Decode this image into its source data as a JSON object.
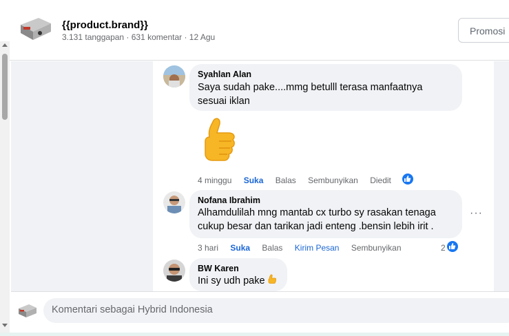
{
  "header": {
    "brand": "{{product.brand}}",
    "meta": "3.131 tanggapan · 631 komentar · 12 Agu",
    "promo_label": "Promosi"
  },
  "comments": [
    {
      "name": "Syahlan Alan",
      "text_line1": "Saya sudah pake....mmg betulll terasa manfaatnya",
      "text_line2": "sesuai iklan",
      "sticker": "thumbs-up",
      "time": "4 minggu",
      "like": "Suka",
      "reply": "Balas",
      "hide": "Sembunyikan",
      "edited": "Diedit"
    },
    {
      "name": "Nofana Ibrahim",
      "text_line1": "Alhamdulilah mng mantab cx turbo sy rasakan tenaga",
      "text_line2": "cukup besar dan tarikan jadi enteng .bensin lebih irit .",
      "time": "3 hari",
      "like": "Suka",
      "reply": "Balas",
      "message": "Kirim Pesan",
      "hide": "Sembunyikan",
      "reaction_count": "2",
      "more": "···"
    },
    {
      "name": "BW Karen",
      "text_line1": "Ini sy udh pake"
    }
  ],
  "input": {
    "placeholder": "Komentari sebagai Hybrid Indonesia"
  },
  "colors": {
    "link_blue": "#1a66d4",
    "like_blue": "#1877f2",
    "bubble_bg": "#f0f2f5"
  }
}
